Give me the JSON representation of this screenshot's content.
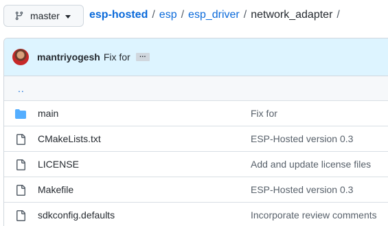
{
  "branch": {
    "icon": "git-branch-icon",
    "label": "master"
  },
  "breadcrumb": {
    "repo": "esp-hosted",
    "parts": [
      "esp",
      "esp_driver"
    ],
    "current": "network_adapter",
    "separator": "/"
  },
  "commit": {
    "author": "mantriyogesh",
    "message": "Fix for",
    "ellipsis": "…"
  },
  "parent_link": "..",
  "files": [
    {
      "type": "directory",
      "icon": "folder-icon",
      "name": "main",
      "message": "Fix for"
    },
    {
      "type": "file",
      "icon": "file-icon",
      "name": "CMakeLists.txt",
      "message": "ESP-Hosted version 0.3"
    },
    {
      "type": "file",
      "icon": "file-icon",
      "name": "LICENSE",
      "message": "Add and update license files"
    },
    {
      "type": "file",
      "icon": "file-icon",
      "name": "Makefile",
      "message": "ESP-Hosted version 0.3"
    },
    {
      "type": "file",
      "icon": "file-icon",
      "name": "sdkconfig.defaults",
      "message": "Incorporate review comments"
    }
  ],
  "colors": {
    "link": "#0969da",
    "header_bg": "#ddf4ff",
    "folder": "#54aeff",
    "file_icon": "#57606a"
  }
}
